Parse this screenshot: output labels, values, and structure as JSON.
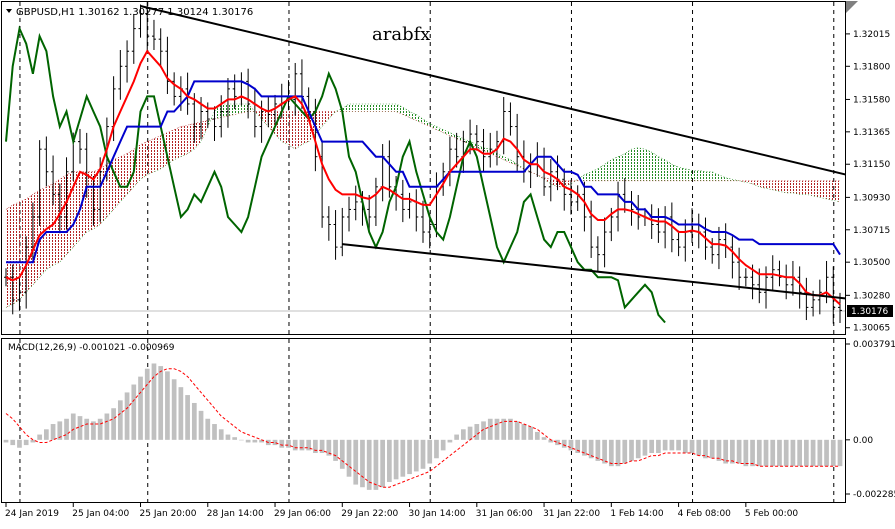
{
  "header": {
    "symbol_info": "GBPUSD,H1  1.30162 1.30277 1.30124 1.30176",
    "watermark": "arabfx"
  },
  "macd_label": "MACD(12,26,9) -0.001021 -0.000969",
  "chart_data": {
    "type": "line",
    "price_axis": {
      "ticks": [
        1.32015,
        1.318,
        1.3158,
        1.31365,
        1.3115,
        1.3093,
        1.30715,
        1.305,
        1.3028,
        1.30065
      ],
      "tick_labels": [
        "1.32015",
        "1.31800",
        "1.31580",
        "1.31365",
        "1.31150",
        "1.30930",
        "1.30715",
        "1.30500",
        "1.30280",
        "1.30065"
      ],
      "ylim": [
        1.3003,
        1.3222
      ],
      "current_price": "1.30176"
    },
    "macd_axis": {
      "tick_labels": [
        "0.003791",
        "0.00",
        "-0.002285"
      ],
      "ticks": [
        0.003791,
        0.0,
        -0.002285
      ],
      "ylim": [
        -0.002285,
        0.003791
      ]
    },
    "time_axis": {
      "labels": [
        "24 Jan 2019",
        "25 Jan 04:00",
        "25 Jan 20:00",
        "28 Jan 14:00",
        "29 Jan 06:00",
        "29 Jan 22:00",
        "30 Jan 14:00",
        "31 Jan 06:00",
        "31 Jan 22:00",
        "1 Feb 14:00",
        "4 Feb 08:00",
        "5 Feb 00:00"
      ],
      "label_bars": [
        0,
        10,
        20,
        30,
        40,
        50,
        60,
        70,
        80,
        90,
        100,
        110
      ],
      "separator_bars": [
        2,
        21,
        42,
        63,
        84,
        102,
        123
      ],
      "bar_count": 125
    },
    "series": [
      {
        "name": "Close",
        "color": "#000000",
        "values": [
          1.304,
          1.3025,
          1.303,
          1.306,
          1.308,
          1.3125,
          1.311,
          1.3095,
          1.308,
          1.311,
          1.313,
          1.3125,
          1.31,
          1.3085,
          1.311,
          1.314,
          1.3165,
          1.318,
          1.319,
          1.3205,
          1.3215,
          1.32,
          1.3198,
          1.319,
          1.317,
          1.316,
          1.3165,
          1.3155,
          1.314,
          1.315,
          1.3145,
          1.314,
          1.315,
          1.3165,
          1.316,
          1.317,
          1.3155,
          1.314,
          1.315,
          1.3148,
          1.3155,
          1.316,
          1.3158,
          1.3175,
          1.316,
          1.315,
          1.312,
          1.308,
          1.3075,
          1.306,
          1.308,
          1.3085,
          1.309,
          1.3085,
          1.308,
          1.31,
          1.312,
          1.31,
          1.3095,
          1.3085,
          1.309,
          1.308,
          1.307,
          1.3075,
          1.31,
          1.311,
          1.3125,
          1.312,
          1.313,
          1.3135,
          1.313,
          1.312,
          1.3125,
          1.313,
          1.315,
          1.314,
          1.312,
          1.311,
          1.3115,
          1.312,
          1.31,
          1.311,
          1.3105,
          1.3095,
          1.309,
          1.3095,
          1.308,
          1.306,
          1.3055,
          1.307,
          1.308,
          1.3095,
          1.309,
          1.3085,
          1.308,
          1.308,
          1.3075,
          1.307,
          1.308,
          1.3065,
          1.306,
          1.307,
          1.3075,
          1.307,
          1.306,
          1.3055,
          1.3065,
          1.306,
          1.305,
          1.304,
          1.304,
          1.3035,
          1.303,
          1.304,
          1.3045,
          1.304,
          1.3035,
          1.304,
          1.303,
          1.302,
          1.3025,
          1.303,
          1.304,
          1.302,
          1.3018
        ]
      },
      {
        "name": "Tenkan",
        "color": "#ff0000",
        "values": [
          1.304,
          1.3038,
          1.304,
          1.3048,
          1.3058,
          1.3068,
          1.3072,
          1.3075,
          1.3082,
          1.309,
          1.31,
          1.311,
          1.3108,
          1.3105,
          1.3112,
          1.3125,
          1.314,
          1.315,
          1.316,
          1.317,
          1.3182,
          1.319,
          1.3185,
          1.318,
          1.3172,
          1.3168,
          1.3165,
          1.316,
          1.3158,
          1.3155,
          1.3152,
          1.3152,
          1.3155,
          1.3158,
          1.3158,
          1.316,
          1.3158,
          1.3155,
          1.3152,
          1.315,
          1.3152,
          1.3155,
          1.3158,
          1.316,
          1.3155,
          1.3145,
          1.313,
          1.3115,
          1.3105,
          1.3098,
          1.3095,
          1.3095,
          1.3095,
          1.3093,
          1.3092,
          1.3095,
          1.31,
          1.3098,
          1.3095,
          1.3092,
          1.3092,
          1.309,
          1.3088,
          1.3088,
          1.3095,
          1.3102,
          1.311,
          1.3115,
          1.312,
          1.3125,
          1.3125,
          1.3122,
          1.3122,
          1.3125,
          1.3132,
          1.313,
          1.3125,
          1.3118,
          1.3115,
          1.3115,
          1.311,
          1.3108,
          1.3105,
          1.31,
          1.3098,
          1.3095,
          1.309,
          1.3082,
          1.3078,
          1.3078,
          1.3082,
          1.3085,
          1.3085,
          1.3084,
          1.3082,
          1.308,
          1.3078,
          1.3077,
          1.3077,
          1.3074,
          1.307,
          1.307,
          1.3071,
          1.307,
          1.3066,
          1.3062,
          1.3062,
          1.3061,
          1.3057,
          1.3052,
          1.3048,
          1.3045,
          1.3042,
          1.3042,
          1.3042,
          1.3041,
          1.304,
          1.304,
          1.3036,
          1.303,
          1.3028,
          1.3028,
          1.303,
          1.3026,
          1.3022
        ]
      },
      {
        "name": "Kijun",
        "color": "#0000cc",
        "values": [
          1.305,
          1.305,
          1.305,
          1.305,
          1.305,
          1.3065,
          1.307,
          1.307,
          1.307,
          1.307,
          1.3075,
          1.3085,
          1.31,
          1.31,
          1.31,
          1.311,
          1.312,
          1.313,
          1.314,
          1.314,
          1.314,
          1.314,
          1.314,
          1.314,
          1.315,
          1.315,
          1.3155,
          1.316,
          1.317,
          1.317,
          1.317,
          1.317,
          1.317,
          1.317,
          1.317,
          1.317,
          1.3168,
          1.3165,
          1.316,
          1.316,
          1.316,
          1.316,
          1.316,
          1.316,
          1.316,
          1.315,
          1.314,
          1.313,
          1.313,
          1.313,
          1.313,
          1.313,
          1.313,
          1.313,
          1.3125,
          1.312,
          1.312,
          1.3115,
          1.311,
          1.311,
          1.31,
          1.31,
          1.31,
          1.31,
          1.31,
          1.3105,
          1.311,
          1.311,
          1.311,
          1.311,
          1.311,
          1.311,
          1.311,
          1.311,
          1.311,
          1.311,
          1.311,
          1.311,
          1.3115,
          1.312,
          1.312,
          1.312,
          1.3115,
          1.311,
          1.311,
          1.3108,
          1.31,
          1.31,
          1.3095,
          1.3095,
          1.3095,
          1.3095,
          1.309,
          1.309,
          1.3085,
          1.3085,
          1.308,
          1.308,
          1.308,
          1.3078,
          1.3075,
          1.3075,
          1.3075,
          1.3075,
          1.3072,
          1.307,
          1.307,
          1.307,
          1.3068,
          1.3065,
          1.3065,
          1.3065,
          1.3062,
          1.3062,
          1.3062,
          1.3062,
          1.3062,
          1.3062,
          1.3062,
          1.3062,
          1.3062,
          1.3062,
          1.3062,
          1.3062,
          1.3055
        ]
      },
      {
        "name": "Chikou",
        "color": "#006400",
        "values": [
          1.313,
          1.318,
          1.3205,
          1.3195,
          1.3175,
          1.32,
          1.319,
          1.316,
          1.314,
          1.315,
          1.313,
          1.3145,
          1.316,
          1.315,
          1.314,
          1.312,
          1.311,
          1.31,
          1.31,
          1.311,
          1.315,
          1.316,
          1.316,
          1.314,
          1.312,
          1.31,
          1.308,
          1.3085,
          1.3095,
          1.309,
          1.31,
          1.311,
          1.31,
          1.308,
          1.3075,
          1.307,
          1.308,
          1.31,
          1.312,
          1.313,
          1.314,
          1.315,
          1.316,
          1.3155,
          1.315,
          1.3145,
          1.315,
          1.316,
          1.3175,
          1.3165,
          1.315,
          1.312,
          1.311,
          1.309,
          1.307,
          1.306,
          1.307,
          1.309,
          1.31,
          1.312,
          1.313,
          1.311,
          1.3095,
          1.308,
          1.307,
          1.3065,
          1.308,
          1.31,
          1.312,
          1.313,
          1.312,
          1.31,
          1.308,
          1.306,
          1.305,
          1.306,
          1.307,
          1.309,
          1.3095,
          1.308,
          1.3065,
          1.306,
          1.307,
          1.307,
          1.306,
          1.305,
          1.3045,
          1.3045,
          1.304,
          1.304,
          1.304,
          1.3038,
          1.302,
          1.3025,
          1.303,
          1.3035,
          1.303,
          1.3015,
          1.301
        ]
      },
      {
        "name": "Senkou A",
        "color": "#228b22",
        "values": [
          1.302,
          1.3022,
          1.3025,
          1.303,
          1.3035,
          1.304,
          1.3045,
          1.3048,
          1.305,
          1.3055,
          1.306,
          1.3065,
          1.307,
          1.3072,
          1.3075,
          1.308,
          1.3085,
          1.309,
          1.3095,
          1.31,
          1.3105,
          1.3108,
          1.311,
          1.3112,
          1.3115,
          1.3118,
          1.312,
          1.3122,
          1.3125,
          1.313,
          1.314,
          1.315,
          1.3155,
          1.3155,
          1.3155,
          1.3155,
          1.3155,
          1.315,
          1.3145,
          1.314,
          1.3135,
          1.313,
          1.3128,
          1.3125,
          1.3128,
          1.313,
          1.3135,
          1.314,
          1.3145,
          1.315,
          1.3152,
          1.3155,
          1.3155,
          1.3155,
          1.3155,
          1.3155,
          1.3155,
          1.3155,
          1.3155,
          1.3153,
          1.315,
          1.3148,
          1.3145,
          1.3142,
          1.314,
          1.3138,
          1.3136,
          1.3134,
          1.3132,
          1.313,
          1.3128,
          1.3126,
          1.3125,
          1.3122,
          1.312,
          1.3118,
          1.3115,
          1.3112,
          1.311,
          1.3108,
          1.3105,
          1.3102,
          1.31,
          1.31,
          1.3102,
          1.3105,
          1.3108,
          1.311,
          1.3112,
          1.3115,
          1.3118,
          1.312,
          1.3122,
          1.3125,
          1.3126,
          1.3125,
          1.3123,
          1.312,
          1.3118,
          1.3115,
          1.3113,
          1.3112,
          1.3111,
          1.3111,
          1.311,
          1.311,
          1.3108,
          1.3106,
          1.3105,
          1.3104,
          1.3103,
          1.3102,
          1.31,
          1.3099,
          1.3098,
          1.3097,
          1.3096,
          1.3096,
          1.3095,
          1.3095,
          1.3094,
          1.3093,
          1.3092,
          1.3091,
          1.309
        ]
      },
      {
        "name": "Senkou B",
        "color": "#b22222",
        "values": [
          1.3085,
          1.3088,
          1.309,
          1.3092,
          1.3095,
          1.3098,
          1.31,
          1.3102,
          1.3105,
          1.3108,
          1.311,
          1.311,
          1.311,
          1.311,
          1.3112,
          1.3115,
          1.3118,
          1.312,
          1.3122,
          1.3125,
          1.3128,
          1.313,
          1.3132,
          1.3134,
          1.3136,
          1.3138,
          1.314,
          1.3141,
          1.3142,
          1.3143,
          1.3144,
          1.3145,
          1.3146,
          1.3147,
          1.3148,
          1.3149,
          1.315,
          1.315,
          1.315,
          1.315,
          1.315,
          1.315,
          1.315,
          1.315,
          1.315,
          1.315,
          1.315,
          1.315,
          1.315,
          1.315,
          1.315,
          1.315,
          1.315,
          1.315,
          1.315,
          1.315,
          1.315,
          1.315,
          1.315,
          1.3148,
          1.3146,
          1.3144,
          1.3142,
          1.314,
          1.3138,
          1.3136,
          1.3134,
          1.3132,
          1.313,
          1.3128,
          1.3126,
          1.3124,
          1.3122,
          1.312,
          1.3118,
          1.3116,
          1.3114,
          1.3112,
          1.311,
          1.3108,
          1.3106,
          1.3105,
          1.3104,
          1.3104,
          1.3104,
          1.3104,
          1.3104,
          1.3104,
          1.3104,
          1.3104,
          1.3104,
          1.3104,
          1.3104,
          1.3104,
          1.3104,
          1.3104,
          1.3104,
          1.3104,
          1.3104,
          1.3104,
          1.3104,
          1.3104,
          1.3104,
          1.3104,
          1.3104,
          1.3104,
          1.3104,
          1.3104,
          1.3104,
          1.3104,
          1.3104,
          1.3104,
          1.3104,
          1.3104,
          1.3104,
          1.3104,
          1.3104,
          1.3104,
          1.3104,
          1.3104,
          1.3104,
          1.3104,
          1.3104,
          1.3104,
          1.3104
        ]
      }
    ],
    "ichimoku_cloud": {
      "color_up": "#228b22",
      "color_down": "#b22222"
    },
    "trendlines": [
      {
        "from": [
          20,
          1.322
        ],
        "to": [
          140,
          1.3092
        ],
        "color": "#000000"
      },
      {
        "from": [
          50,
          1.3062
        ],
        "to": [
          133,
          1.3022
        ],
        "color": "#000000"
      }
    ],
    "macd": {
      "histogram": [
        -0.0001,
        -0.0002,
        -0.0003,
        -0.0002,
        -0.0001,
        0.0002,
        0.0004,
        0.0006,
        0.0007,
        0.0008,
        0.001,
        0.0009,
        0.0008,
        0.0007,
        0.0008,
        0.001,
        0.0012,
        0.0015,
        0.0018,
        0.0021,
        0.0024,
        0.0027,
        0.0029,
        0.0028,
        0.0026,
        0.0023,
        0.002,
        0.0017,
        0.0014,
        0.0011,
        0.0008,
        0.0006,
        0.0004,
        0.0002,
        0.0001,
        0.0,
        -0.0001,
        -0.0001,
        -0.0001,
        -0.0002,
        -0.0002,
        -0.0003,
        -0.0003,
        -0.0004,
        -0.0004,
        -0.0004,
        -0.0005,
        -0.0005,
        -0.0006,
        -0.0008,
        -0.0011,
        -0.0014,
        -0.0017,
        -0.0018,
        -0.0019,
        -0.0019,
        -0.0018,
        -0.0016,
        -0.0015,
        -0.0014,
        -0.0013,
        -0.0012,
        -0.0011,
        -0.0009,
        -0.0007,
        -0.0004,
        -0.0001,
        0.0002,
        0.0004,
        0.0005,
        0.0006,
        0.0007,
        0.0008,
        0.0008,
        0.0008,
        0.0008,
        0.0007,
        0.0006,
        0.0005,
        0.0003,
        0.0001,
        -0.0001,
        -0.0002,
        -0.0003,
        -0.0004,
        -0.0005,
        -0.0006,
        -0.0007,
        -0.0008,
        -0.0009,
        -0.001,
        -0.001,
        -0.0009,
        -0.0008,
        -0.0007,
        -0.0006,
        -0.0005,
        -0.0005,
        -0.0004,
        -0.0004,
        -0.0004,
        -0.0005,
        -0.0005,
        -0.0006,
        -0.0007,
        -0.0007,
        -0.0008,
        -0.0009,
        -0.0009,
        -0.0009,
        -0.001,
        -0.001,
        -0.001,
        -0.001,
        -0.001,
        -0.001,
        -0.001,
        -0.001,
        -0.001,
        -0.001,
        -0.001,
        -0.001,
        -0.001,
        -0.001,
        -0.001
      ],
      "signal": [
        0.001,
        0.0008,
        0.0005,
        0.0002,
        0.0,
        -0.0001,
        -0.0001,
        0.0,
        0.0001,
        0.0002,
        0.0004,
        0.0005,
        0.0006,
        0.0006,
        0.0006,
        0.0007,
        0.0008,
        0.001,
        0.0012,
        0.0015,
        0.0018,
        0.0021,
        0.0024,
        0.0026,
        0.0027,
        0.0027,
        0.0026,
        0.0024,
        0.0021,
        0.0018,
        0.0015,
        0.0012,
        0.0009,
        0.0007,
        0.0005,
        0.0003,
        0.0002,
        0.0001,
        0.0,
        -0.0001,
        -0.0001,
        -0.0002,
        -0.0002,
        -0.0003,
        -0.0003,
        -0.0003,
        -0.0004,
        -0.0004,
        -0.0005,
        -0.0006,
        -0.0008,
        -0.001,
        -0.0012,
        -0.0014,
        -0.0016,
        -0.0017,
        -0.0018,
        -0.0018,
        -0.0017,
        -0.0016,
        -0.0015,
        -0.0014,
        -0.0013,
        -0.0012,
        -0.001,
        -0.0008,
        -0.0006,
        -0.0004,
        -0.0002,
        0.0,
        0.0002,
        0.0004,
        0.0005,
        0.0006,
        0.0007,
        0.0007,
        0.0007,
        0.0006,
        0.0005,
        0.0004,
        0.0002,
        0.0,
        -0.0001,
        -0.0002,
        -0.0003,
        -0.0004,
        -0.0005,
        -0.0006,
        -0.0007,
        -0.0008,
        -0.0009,
        -0.0009,
        -0.0009,
        -0.0008,
        -0.0008,
        -0.0007,
        -0.0006,
        -0.0006,
        -0.0005,
        -0.0005,
        -0.0005,
        -0.0005,
        -0.0005,
        -0.0006,
        -0.0006,
        -0.0007,
        -0.0007,
        -0.0008,
        -0.0008,
        -0.0009,
        -0.0009,
        -0.0009,
        -0.001,
        -0.001,
        -0.001,
        -0.001,
        -0.001,
        -0.001,
        -0.001,
        -0.001,
        -0.001,
        -0.001,
        -0.001,
        -0.001,
        -0.001
      ],
      "histogram_color": "#c0c0c0",
      "signal_color": "#ff0000"
    },
    "grid": true,
    "legend": "none"
  }
}
